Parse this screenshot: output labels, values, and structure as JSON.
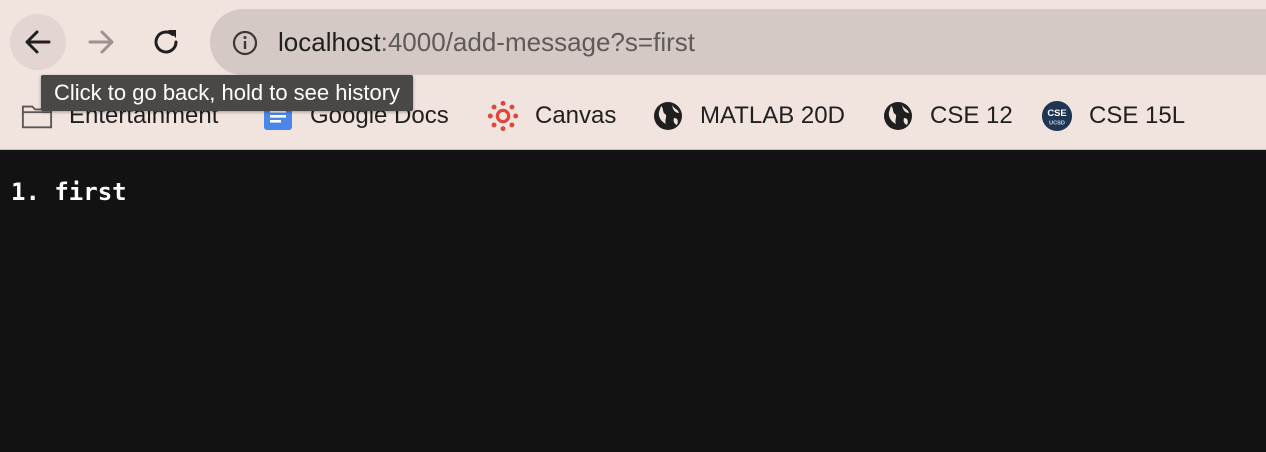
{
  "toolbar": {
    "back_tooltip": "Click to go back, hold to see history"
  },
  "address_bar": {
    "host": "localhost",
    "rest": ":4000/add-message?s=first"
  },
  "bookmarks": [
    {
      "label": "Entertainment",
      "icon": "folder-icon"
    },
    {
      "label": "Google Docs",
      "icon": "google-docs-icon"
    },
    {
      "label": "Canvas",
      "icon": "canvas-icon"
    },
    {
      "label": "MATLAB 20D",
      "icon": "globe-icon"
    },
    {
      "label": "CSE 12",
      "icon": "globe-icon"
    },
    {
      "label": "CSE 15L",
      "icon": "cse-ucsd-icon",
      "icon_text_top": "CSE",
      "icon_text_bottom": "UCSD"
    }
  ],
  "page": {
    "lines": [
      {
        "number": "1.",
        "text": "first"
      }
    ]
  },
  "colors": {
    "chrome_bg": "#f1e3de",
    "omnibox_bg": "#d5c9c6",
    "page_bg": "#121212",
    "canvas_red": "#e0463a",
    "docs_blue": "#4a87e8",
    "cse_navy": "#1f3552"
  }
}
